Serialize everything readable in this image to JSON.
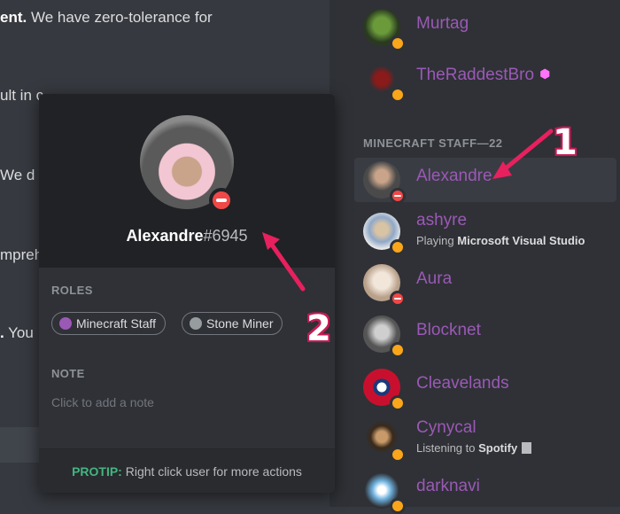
{
  "chat": {
    "lines": [
      {
        "bold": "ent.",
        "text": " We have zero-tolerance for"
      },
      {
        "bold": "",
        "text": "ult in c"
      },
      {
        "bold": "",
        "text": "We d"
      },
      {
        "bold": "",
        "text": "mpreh"
      },
      {
        "bold": ".",
        "text": " You"
      }
    ]
  },
  "members": {
    "top": [
      {
        "name": "Murtag",
        "status": "idle"
      },
      {
        "name": "TheRaddestBro",
        "status": "idle",
        "badge": "nitro-icon"
      }
    ],
    "section_header": "MINECRAFT STAFF—22",
    "staff": [
      {
        "name": "Alexandre",
        "status": "dnd",
        "selected": true
      },
      {
        "name": "ashyre",
        "status": "idle",
        "activity_prefix": "Playing",
        "activity_name": "Microsoft Visual Studio"
      },
      {
        "name": "Aura",
        "status": "dnd"
      },
      {
        "name": "Blocknet",
        "status": "idle"
      },
      {
        "name": "Cleavelands",
        "status": "idle"
      },
      {
        "name": "Cynycal",
        "status": "idle",
        "activity_prefix": "Listening to",
        "activity_name": "Spotify"
      },
      {
        "name": "darknavi",
        "status": "idle"
      }
    ]
  },
  "popout": {
    "username": "Alexandre",
    "discriminator": "#6945",
    "roles_label": "ROLES",
    "roles": [
      {
        "name": "Minecraft Staff",
        "color": "#9b59b6"
      },
      {
        "name": "Stone Miner",
        "color": "#979c9f"
      }
    ],
    "note_label": "NOTE",
    "note_placeholder": "Click to add a note",
    "protip_label": "PROTIP:",
    "protip_text": " Right click user for more actions"
  },
  "annotations": {
    "first": "1",
    "second": "2"
  },
  "colors": {
    "accent": "#9b59b6",
    "annotation": "#e8205e",
    "idle": "#faa61a",
    "dnd": "#f04747"
  }
}
